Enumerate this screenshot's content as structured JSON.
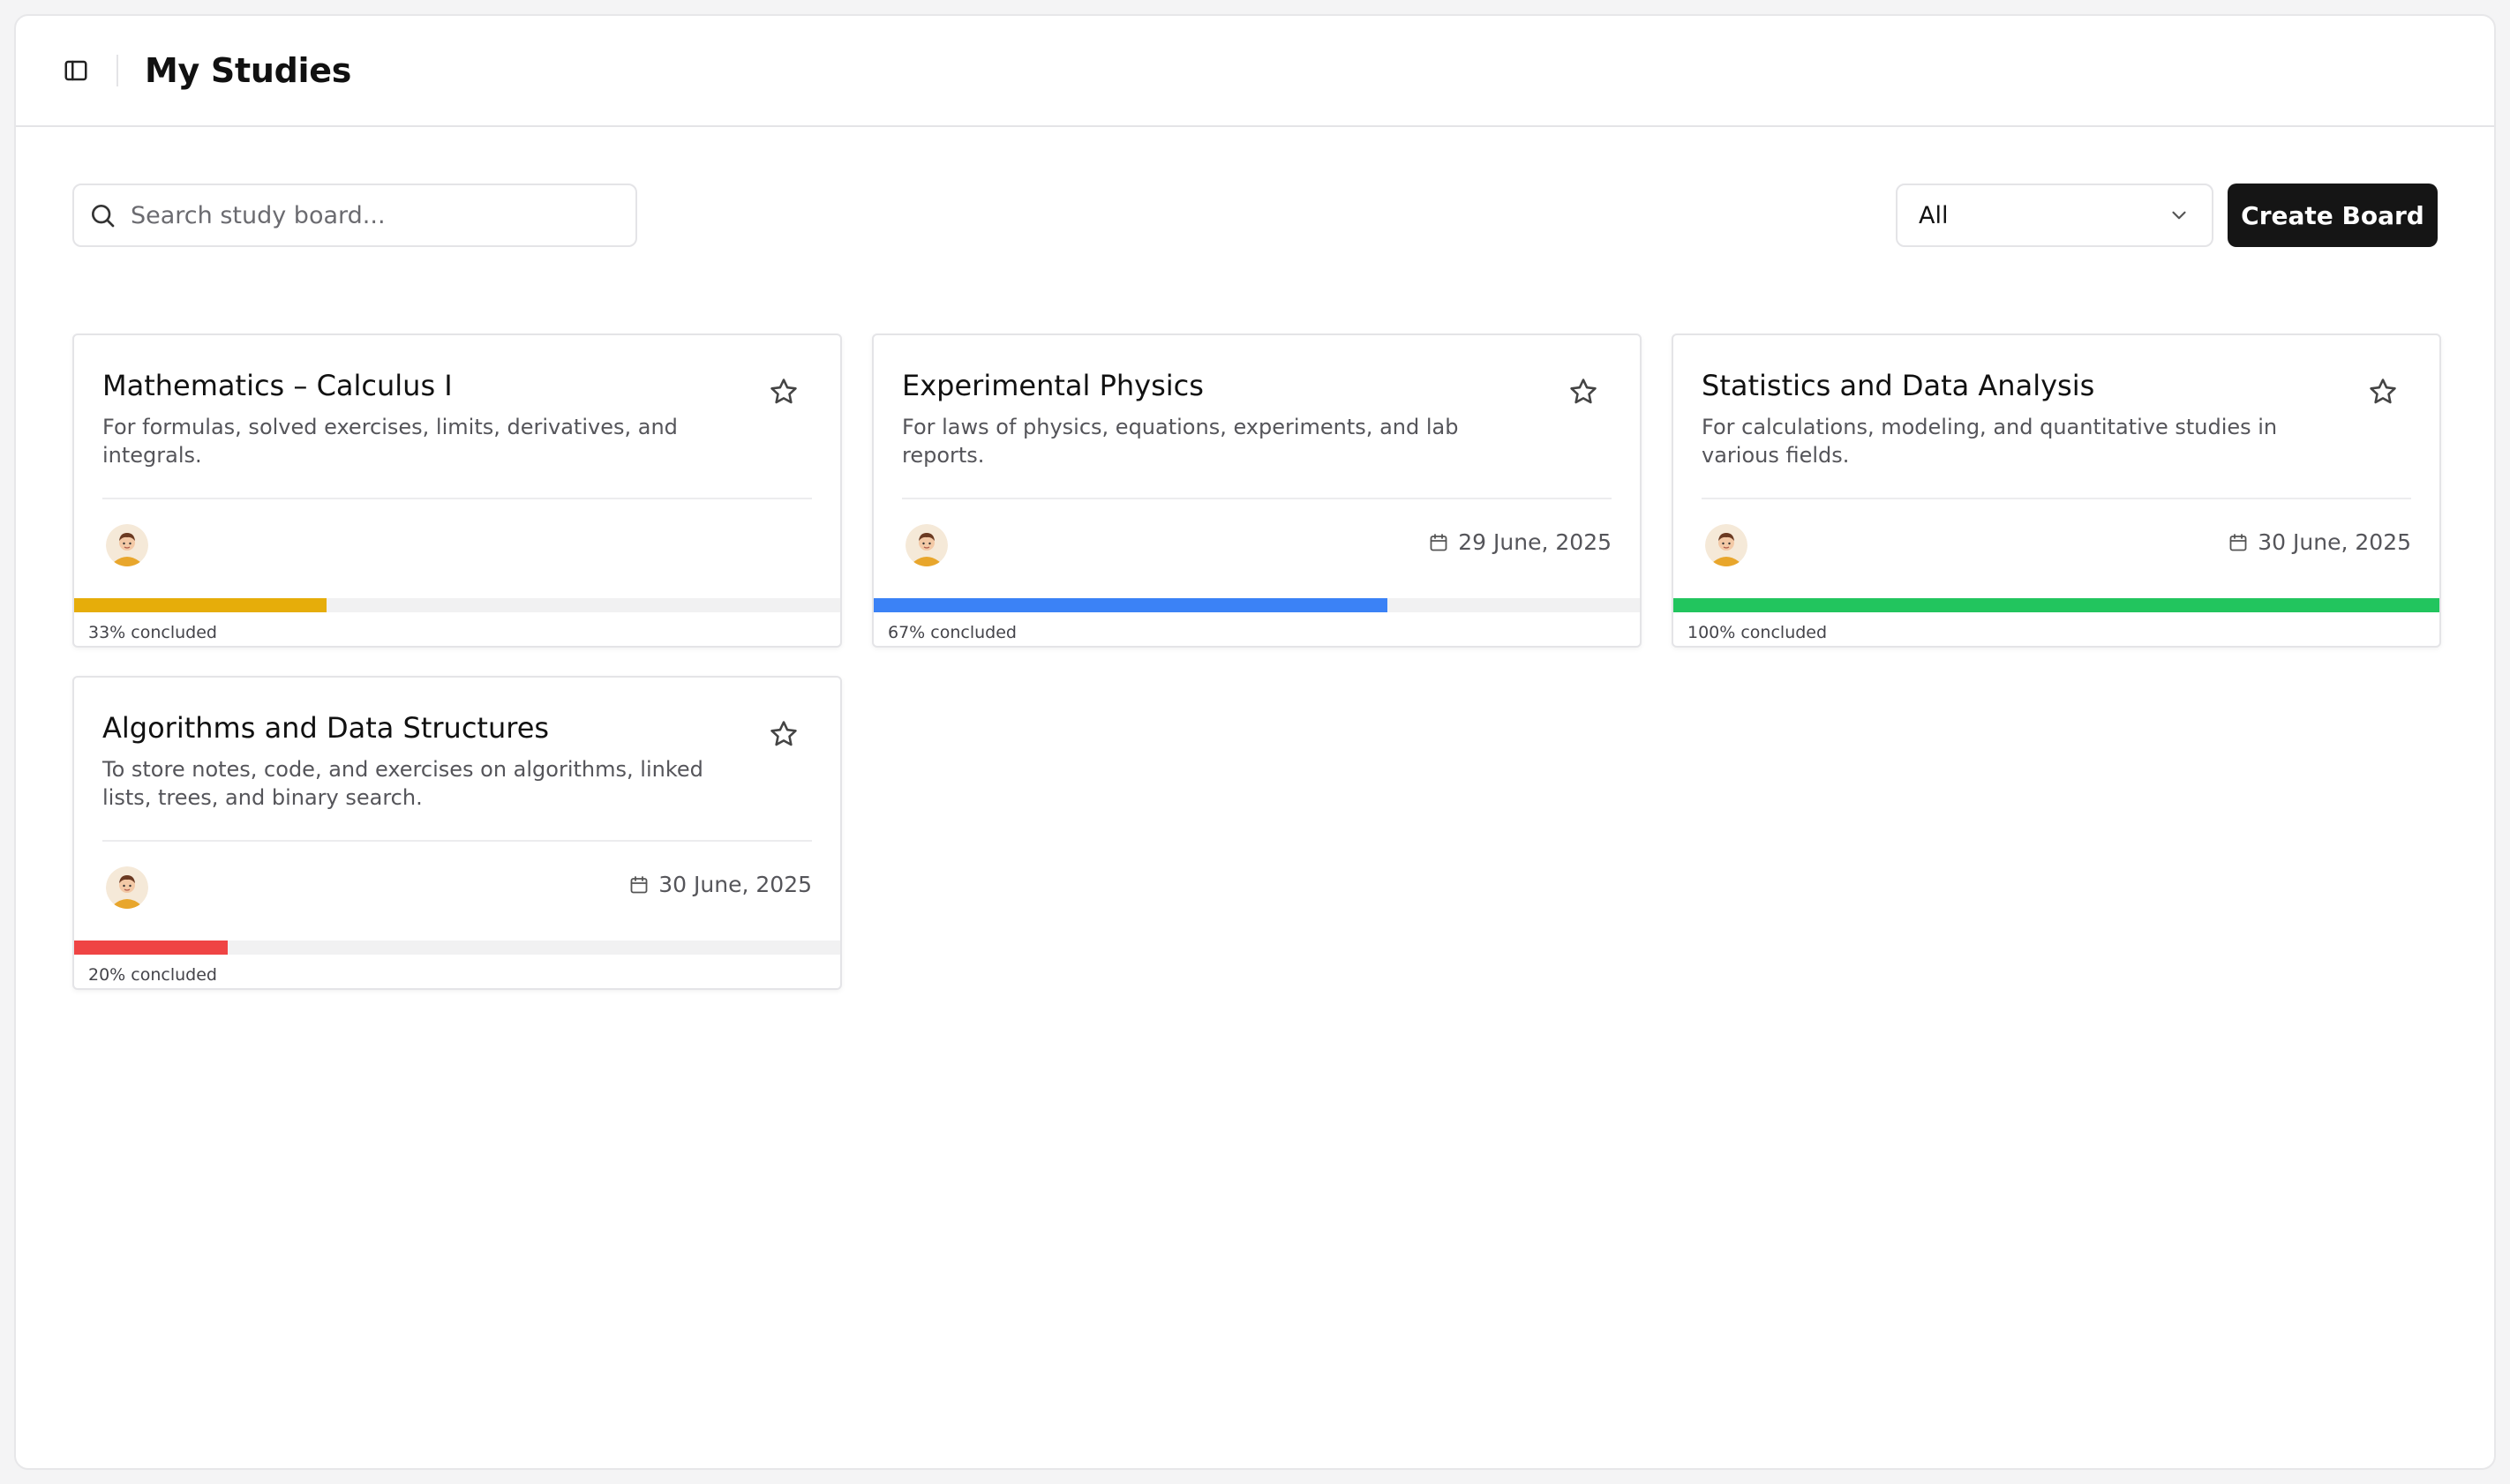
{
  "header": {
    "title": "My Studies",
    "sidebar_toggle_icon": "sidebar-panel-icon"
  },
  "toolbar": {
    "search": {
      "placeholder": "Search study board...",
      "value": "",
      "icon": "search-icon"
    },
    "filter": {
      "value": "All",
      "icon": "chevron-down-icon"
    },
    "create_label": "Create Board"
  },
  "boards": [
    {
      "title": "Mathematics – Calculus I",
      "description": "For formulas, solved exercises, limits, derivatives, and integrals.",
      "date": "",
      "progress": 33,
      "progress_label": "33% concluded",
      "color": "#e6ad0a"
    },
    {
      "title": "Experimental Physics",
      "description": "For laws of physics, equations, experiments, and lab reports.",
      "date": "29 June, 2025",
      "progress": 67,
      "progress_label": "67% concluded",
      "color": "#3b82f6"
    },
    {
      "title": "Statistics and Data Analysis",
      "description": "For calculations, modeling, and quantitative studies in various fields.",
      "date": "30 June, 2025",
      "progress": 100,
      "progress_label": "100% concluded",
      "color": "#22c55e"
    },
    {
      "title": "Algorithms and Data Structures",
      "description": "To store notes, code, and exercises on algorithms, linked lists, trees, and binary search.",
      "date": "30 June, 2025",
      "progress": 20,
      "progress_label": "20% concluded",
      "color": "#ef4444"
    }
  ]
}
